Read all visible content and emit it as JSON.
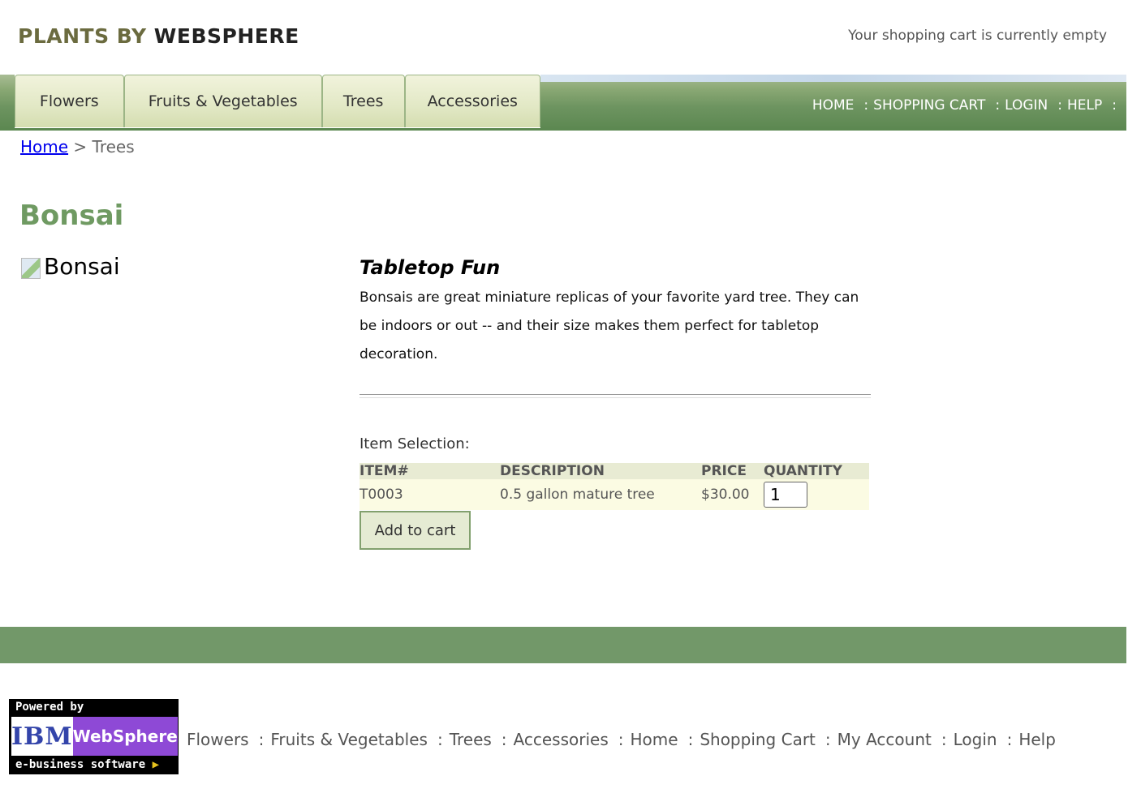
{
  "header": {
    "logo_part1": "PLANTS BY",
    "logo_part2": "WEBSPHERE",
    "cart_status": "Your shopping cart is currently empty"
  },
  "tabs": [
    {
      "label": "Flowers"
    },
    {
      "label": "Fruits & Vegetables"
    },
    {
      "label": "Trees"
    },
    {
      "label": "Accessories"
    }
  ],
  "top_nav": {
    "home": "HOME",
    "cart": "SHOPPING CART",
    "login": "LOGIN",
    "help": "HELP",
    "separator": ":"
  },
  "breadcrumb": {
    "home": "Home",
    "separator": ">",
    "current": "Trees"
  },
  "product": {
    "title": "Bonsai",
    "image_alt": "Bonsai",
    "tagline": "Tabletop Fun",
    "description": "Bonsais are great miniature replicas of your favorite yard tree. They can be indoors or out -- and their size makes them perfect for tabletop decoration."
  },
  "item_selection": {
    "label": "Item Selection:",
    "columns": [
      "ITEM#",
      "DESCRIPTION",
      "PRICE",
      "QUANTITY"
    ],
    "rows": [
      {
        "item": "T0003",
        "description": "0.5 gallon mature tree",
        "price": "$30.00",
        "quantity": "1"
      }
    ],
    "add_button": "Add to cart"
  },
  "badge": {
    "powered_by": "Powered by",
    "ibm": "IBM",
    "product": "WebSphere",
    "tagline": "e-business software"
  },
  "footer_nav": {
    "separator": ":",
    "links": [
      "Flowers",
      "Fruits & Vegetables",
      "Trees",
      "Accessories",
      "Home",
      "Shopping Cart",
      "My Account",
      "Login",
      "Help"
    ]
  },
  "colors": {
    "nav_green": "#6d9460",
    "title_green": "#6f9a62",
    "footer_green": "#729869",
    "tab_bg": "#e2e8c5",
    "row_bg": "#fbfbe3",
    "header_row_bg": "#e8ebd3"
  }
}
